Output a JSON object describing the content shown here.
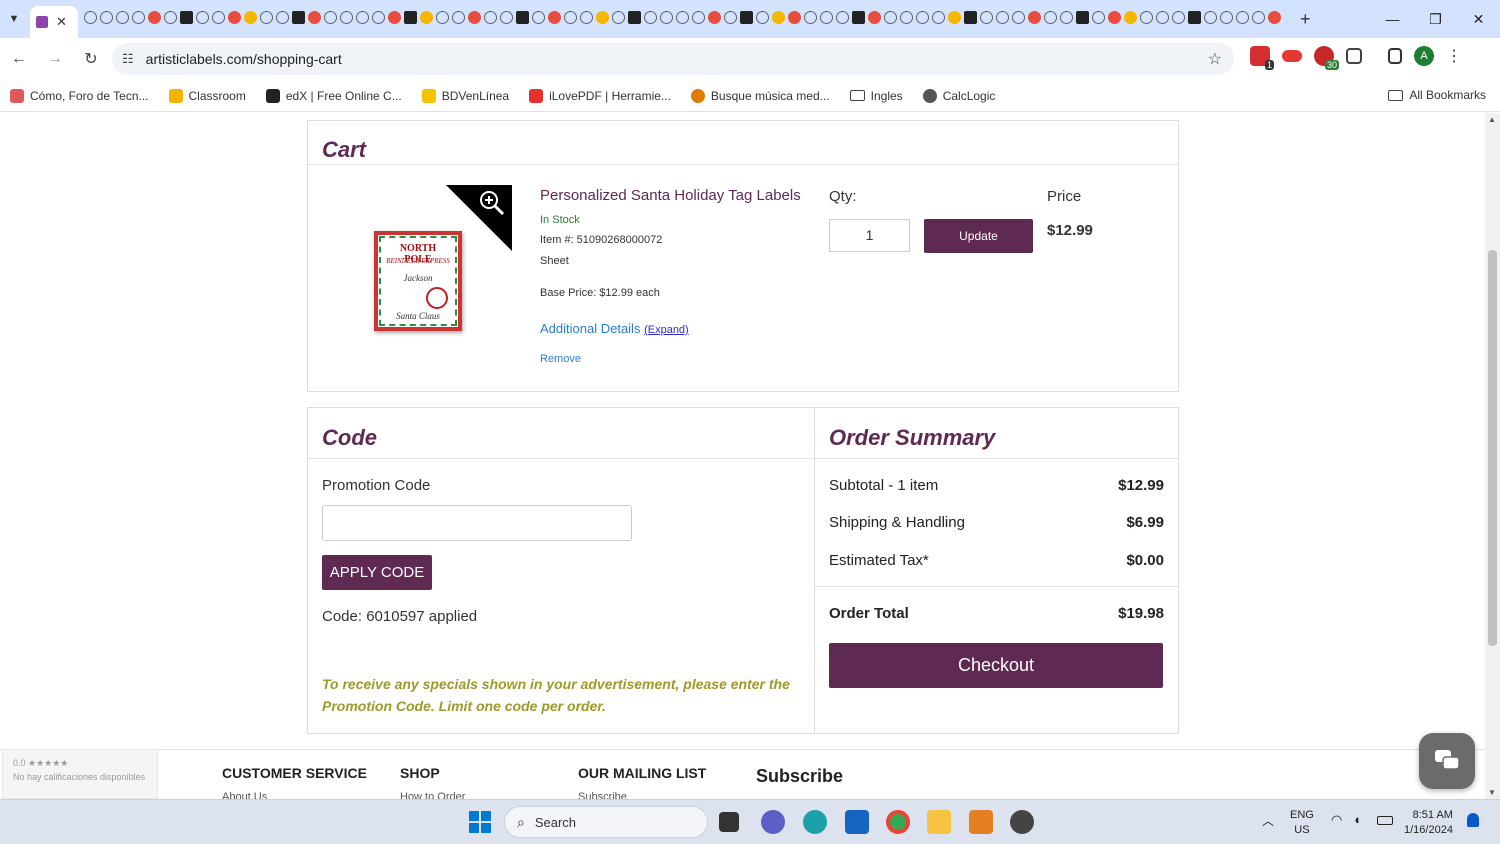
{
  "browser": {
    "url": "artisticlabels.com/shopping-cart",
    "bookmarks": [
      {
        "label": "Cómo, Foro de Tecn...",
        "color": "#e05a5a"
      },
      {
        "label": "Classroom",
        "color": "#f5b400"
      },
      {
        "label": "edX | Free Online C...",
        "color": "#222222"
      },
      {
        "label": "BDVenLínea",
        "color": "#f5c400"
      },
      {
        "label": "iLovePDF | Herramie...",
        "color": "#e5322d"
      },
      {
        "label": "Busque música med...",
        "color": "#e07b00"
      },
      {
        "label": "Ingles",
        "color": "#444444"
      },
      {
        "label": "CalcLogic",
        "color": "#555555"
      }
    ],
    "all_bookmarks": "All Bookmarks",
    "profile_initial": "A",
    "ext_badge_1": "1",
    "ext_badge_30": "30"
  },
  "cart": {
    "title": "Cart",
    "product": {
      "name": "Personalized Santa Holiday Tag Labels",
      "stock": "In Stock",
      "item_no": "Item #: 51090268000072",
      "format": "Sheet",
      "base_price": "Base Price: $12.99 each",
      "additional": "Additional Details",
      "expand": "(Expand)",
      "remove": "Remove",
      "qty_label": "Qty:",
      "qty_value": "1",
      "update_label": "Update",
      "price_label": "Price",
      "price_value": "$12.99",
      "thumb": {
        "line1": "NORTH POLE",
        "line2": "REINDEER EXPRESS",
        "name": "Jackson",
        "signature": "Santa Claus"
      }
    }
  },
  "code": {
    "title": "Code",
    "promo_label": "Promotion Code",
    "promo_value": "",
    "apply_label": "APPLY CODE",
    "applied_text": "Code: 6010597 applied",
    "note": "To receive any specials shown in your advertisement, please enter the Promotion Code. Limit one code per order."
  },
  "summary": {
    "title": "Order Summary",
    "rows": [
      {
        "label": "Subtotal - 1 item",
        "value": "$12.99"
      },
      {
        "label": "Shipping & Handling",
        "value": "$6.99"
      },
      {
        "label": "Estimated Tax*",
        "value": "$0.00"
      }
    ],
    "total_label": "Order Total",
    "total_value": "$19.98",
    "checkout_label": "Checkout"
  },
  "footer": {
    "rating_score": "0.0 ★★★★★",
    "rating_text": "No hay calificaciones disponibles",
    "col1": "CUSTOMER SERVICE",
    "col1_sub": "About Us",
    "col2": "SHOP",
    "col2_sub": "How to Order",
    "col3": "OUR MAILING LIST",
    "col3_sub": "Subscribe",
    "subscribe": "Subscribe"
  },
  "taskbar": {
    "search_placeholder": "Search",
    "lang_1": "ENG",
    "lang_2": "US",
    "time": "8:51 AM",
    "date": "1/16/2024"
  },
  "colors": {
    "brand_purple": "#5e2a52",
    "in_stock_green": "#2e7d32",
    "note_olive": "#9c9a2a",
    "link_blue": "#2b7bd4"
  }
}
